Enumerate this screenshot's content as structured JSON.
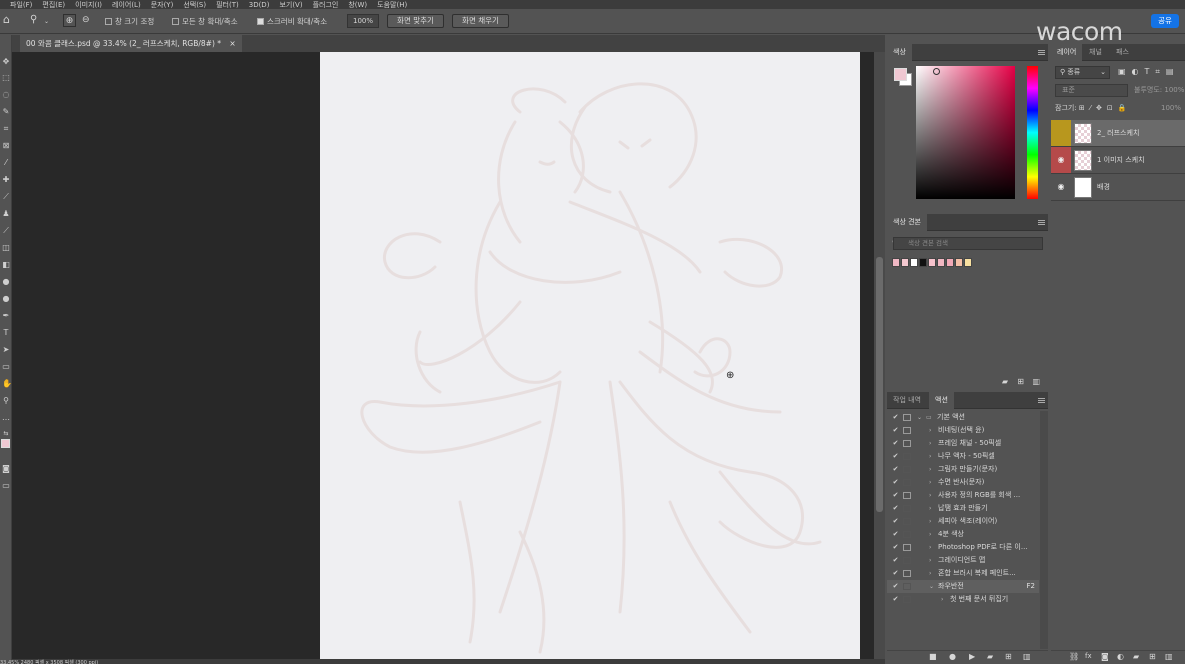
{
  "menubar": {
    "items": [
      "파일(F)",
      "편집(E)",
      "이미지(I)",
      "레이어(L)",
      "문자(Y)",
      "선택(S)",
      "필터(T)",
      "3D(D)",
      "보기(V)",
      "플러그인",
      "창(W)",
      "도움말(H)"
    ]
  },
  "options": {
    "resize_windows": "창 크기 조정",
    "zoom_all": "모든 창 확대/축소",
    "scrubby": "스크러비 확대/축소",
    "zoom_value": "100%",
    "fit_screen": "화면 맞추기",
    "fill_screen": "화면 채우기",
    "share": "공유"
  },
  "branding": {
    "logo": "wacom"
  },
  "document": {
    "tab_title": "00 와콤 클래스.psd @ 33.4% (2_ 러프스케치, RGB/8#) *",
    "status": "33.45%  2480 픽셀 x 3508 픽셀 (300 ppi)"
  },
  "color_panel": {
    "title": "색상",
    "fg_color": "#f0c8d2",
    "bg_color": "#ffffff"
  },
  "swatches_panel": {
    "title": "색상 견본",
    "search_placeholder": "색상 견본 검색",
    "swatches": [
      "#f0b8c4",
      "#f4c8d0",
      "#ffffff",
      "#111111",
      "#f6c2cc",
      "#f1b7c2",
      "#f2aab8",
      "#f6c0a8",
      "#f8e0a0"
    ]
  },
  "history_panel": {
    "tabs": [
      "작업 내역",
      "액션"
    ],
    "active_tab": "액션",
    "actions": [
      {
        "label": "기본 액션",
        "dlg": true,
        "level": 0,
        "folder": true,
        "open": true
      },
      {
        "label": "비네팅(선택 윤)",
        "dlg": true,
        "level": 1
      },
      {
        "label": "프레임 채널 - 50픽셀",
        "dlg": true,
        "level": 1
      },
      {
        "label": "나무 액자 - 50픽셀",
        "dlg": false,
        "level": 1
      },
      {
        "label": "그림자 만들기(문자)",
        "dlg": false,
        "level": 1
      },
      {
        "label": "수면 반사(문자)",
        "dlg": false,
        "level": 1
      },
      {
        "label": "사용자 정의 RGB를 회색 ...",
        "dlg": true,
        "level": 1
      },
      {
        "label": "납땜 효과 만들기",
        "dlg": false,
        "level": 1
      },
      {
        "label": "세피아 색조(레이어)",
        "dlg": false,
        "level": 1
      },
      {
        "label": "4분 색상",
        "dlg": false,
        "level": 1
      },
      {
        "label": "Photoshop PDF로 다른 이...",
        "dlg": true,
        "level": 1
      },
      {
        "label": "그레이디언트 맵",
        "dlg": false,
        "level": 1
      },
      {
        "label": "혼합 브러시 복제 페인트...",
        "dlg": true,
        "level": 1
      },
      {
        "label": "좌우반전",
        "dlg": false,
        "level": 1,
        "open": true,
        "key": "F2",
        "selected": true
      },
      {
        "label": "첫 번째 문서 뒤집기",
        "dlg": false,
        "level": 2
      }
    ]
  },
  "layers_panel": {
    "tabs": [
      "레이어",
      "채널",
      "패스"
    ],
    "kind_filter": "종류",
    "blend_mode": "표준",
    "opacity_label": "불투명도:",
    "opacity_value": "100%",
    "lock_label": "잠그기:",
    "fill_value": "100%",
    "layers": [
      {
        "name": "2_ 러프스케치",
        "visible": false,
        "color": "#b8971e",
        "selected": true
      },
      {
        "name": "1 이미지 스케치",
        "visible": true,
        "color": "#b54a4a",
        "selected": false
      },
      {
        "name": "배경",
        "visible": true,
        "color": "",
        "selected": false
      }
    ]
  }
}
